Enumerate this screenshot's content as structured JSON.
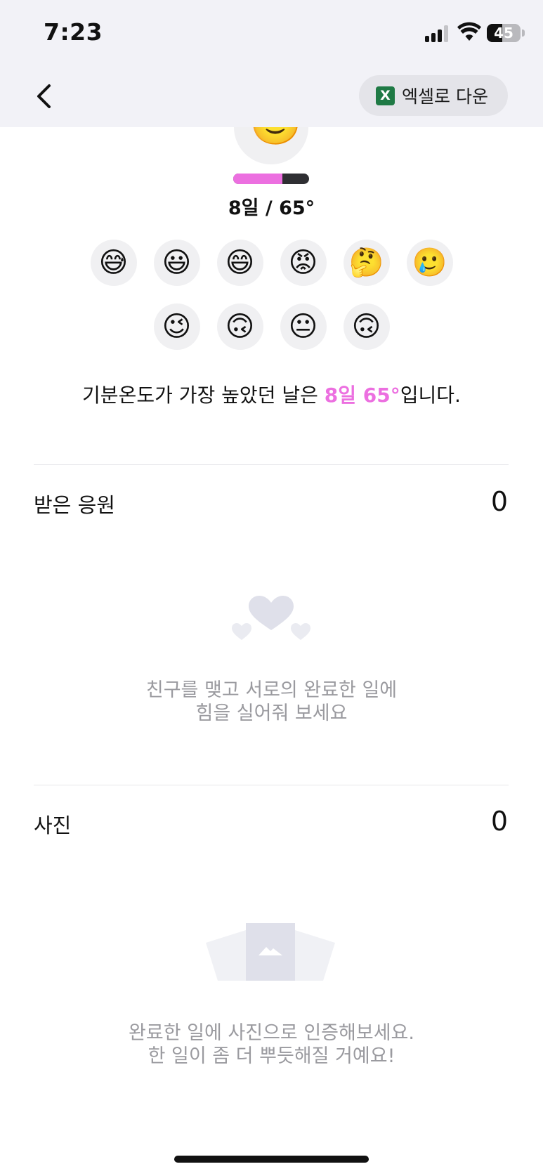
{
  "status_bar": {
    "time": "7:23",
    "battery_level": "45",
    "battery_fraction": 0.45
  },
  "nav": {
    "excel_button_icon": "X",
    "excel_button_label": "엑셀로 다운"
  },
  "mood": {
    "top_face": "🙂",
    "temperature_fraction": 0.65,
    "summary": "8일 / 65°",
    "emojis_row1": [
      "😅",
      "😃",
      "😄",
      "😡",
      "🤔",
      "🥲"
    ],
    "emojis_row2": [
      "😉",
      "🙃",
      "😐",
      "🙃"
    ],
    "highest_prefix": "기분온도가 가장 높았던 날은 ",
    "highest_value": "8일 65°",
    "highest_suffix": "입니다."
  },
  "cheers": {
    "title": "받은 응원",
    "count": "0",
    "empty_line1": "친구를 맺고 서로의 완료한 일에",
    "empty_line2": "힘을 실어줘 보세요"
  },
  "photos": {
    "title": "사진",
    "count": "0",
    "empty_line1": "완료한 일에 사진으로 인증해보세요.",
    "empty_line2": "한 일이 좀 더 뿌듯해질 거예요!"
  },
  "icons": {
    "back": "chevron-left-icon",
    "cheers_empty": "hearts-icon",
    "photos_empty": "photo-icon"
  },
  "colors": {
    "accent_pink": "#ec6fe0",
    "excel_green": "#1f7a45",
    "header_bg": "#f2f2f7",
    "muted_text": "#9a9a9f"
  }
}
